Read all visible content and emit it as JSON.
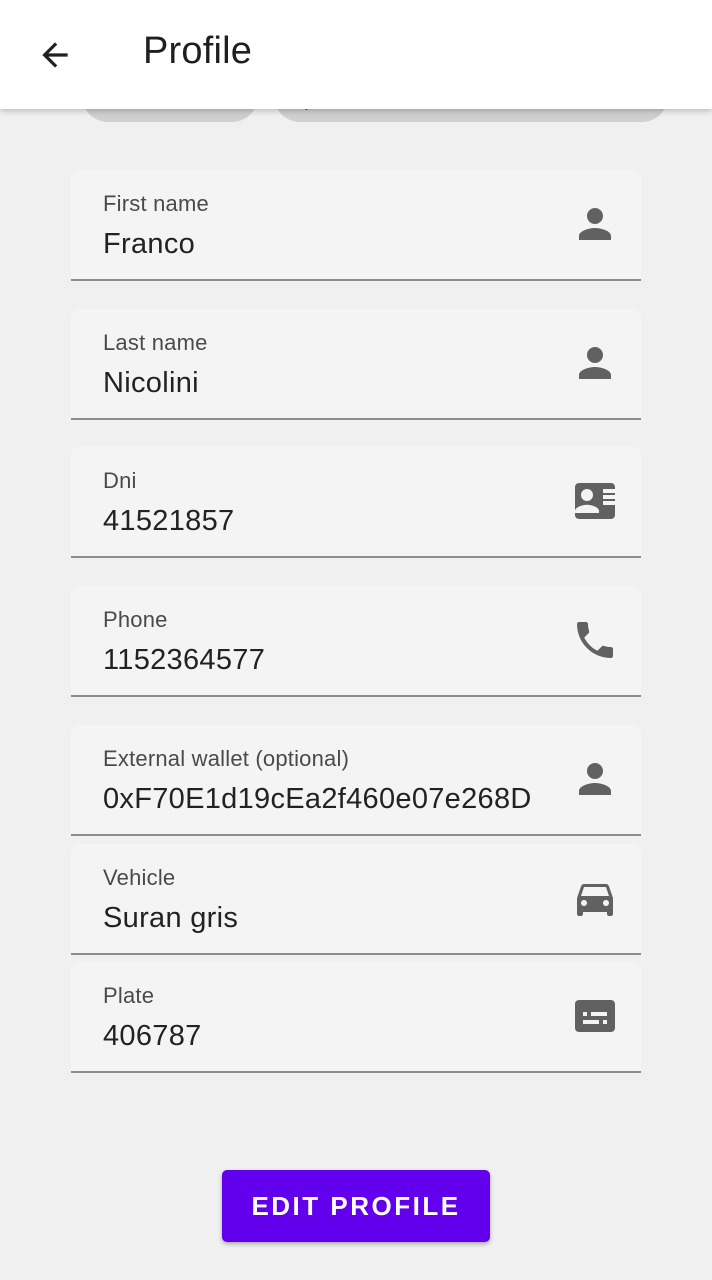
{
  "appbar": {
    "title": "Profile",
    "back_icon": "arrow-back-icon"
  },
  "chips": {
    "right_label": "("
  },
  "fields": [
    {
      "key": "first_name",
      "label": "First name",
      "value": "Franco",
      "icon": "person-icon"
    },
    {
      "key": "last_name",
      "label": "Last name",
      "value": "Nicolini",
      "icon": "person-icon"
    },
    {
      "key": "dni",
      "label": "Dni",
      "value": "41521857",
      "icon": "id-card-icon"
    },
    {
      "key": "phone",
      "label": "Phone",
      "value": "1152364577",
      "icon": "phone-icon"
    },
    {
      "key": "external_wallet",
      "label": "External wallet (optional)",
      "value": "0xF70E1d19cEa2f460e07e268D",
      "icon": "person-icon"
    },
    {
      "key": "vehicle",
      "label": "Vehicle",
      "value": "Suran gris",
      "icon": "car-icon"
    },
    {
      "key": "plate",
      "label": "Plate",
      "value": "406787",
      "icon": "plate-card-icon"
    }
  ],
  "actions": {
    "edit_profile_label": "EDIT PROFILE"
  },
  "colors": {
    "primary": "#6200ee",
    "field_background": "#f4f4f4",
    "icon": "#616161"
  }
}
